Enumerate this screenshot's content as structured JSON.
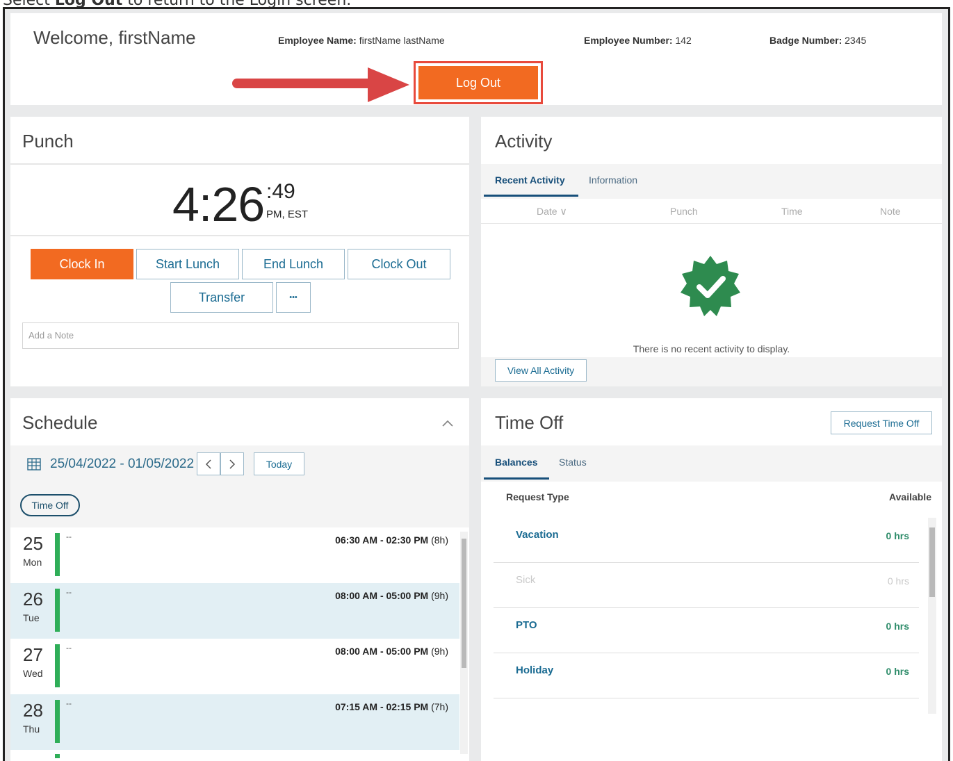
{
  "caption": {
    "prefix": "Select ",
    "bold": "Log Out",
    "suffix": " to return to the Login screen."
  },
  "header": {
    "welcome": "Welcome, firstName",
    "employee_name_label": "Employee Name:",
    "employee_name": "firstName lastName",
    "employee_number_label": "Employee Number:",
    "employee_number": "142",
    "badge_number_label": "Badge Number:",
    "badge_number": "2345",
    "logout_label": "Log Out"
  },
  "punch": {
    "title": "Punch",
    "time": "4:26",
    "seconds": ":49",
    "tz": "PM, EST",
    "buttons": [
      "Clock In",
      "Start Lunch",
      "End Lunch",
      "Clock Out",
      "Transfer",
      "•••"
    ],
    "note_placeholder": "Add a Note"
  },
  "activity": {
    "title": "Activity",
    "tabs": [
      "Recent Activity",
      "Information"
    ],
    "columns": [
      "Date ∨",
      "Punch",
      "Time",
      "Note"
    ],
    "empty_message": "There is no recent activity to display.",
    "view_all": "View All Activity"
  },
  "schedule": {
    "title": "Schedule",
    "date_range": "25/04/2022 - 01/05/2022",
    "today": "Today",
    "filter_pill": "Time Off",
    "days": [
      {
        "num": "25",
        "name": "Mon",
        "dash": "--",
        "shift": "06:30 AM - 02:30 PM",
        "hours": "(8h)"
      },
      {
        "num": "26",
        "name": "Tue",
        "dash": "--",
        "shift": "08:00 AM - 05:00 PM",
        "hours": "(9h)"
      },
      {
        "num": "27",
        "name": "Wed",
        "dash": "--",
        "shift": "08:00 AM - 05:00 PM",
        "hours": "(9h)"
      },
      {
        "num": "28",
        "name": "Thu",
        "dash": "--",
        "shift": "07:15 AM - 02:15 PM",
        "hours": "(7h)"
      }
    ]
  },
  "timeoff": {
    "title": "Time Off",
    "request_button": "Request Time Off",
    "tabs": [
      "Balances",
      "Status"
    ],
    "col_type": "Request Type",
    "col_available": "Available",
    "rows": [
      {
        "type": "Vacation",
        "available": "0 hrs"
      },
      {
        "type": "Sick",
        "available": "0 hrs"
      },
      {
        "type": "PTO",
        "available": "0 hrs"
      },
      {
        "type": "Holiday",
        "available": "0 hrs"
      }
    ]
  }
}
